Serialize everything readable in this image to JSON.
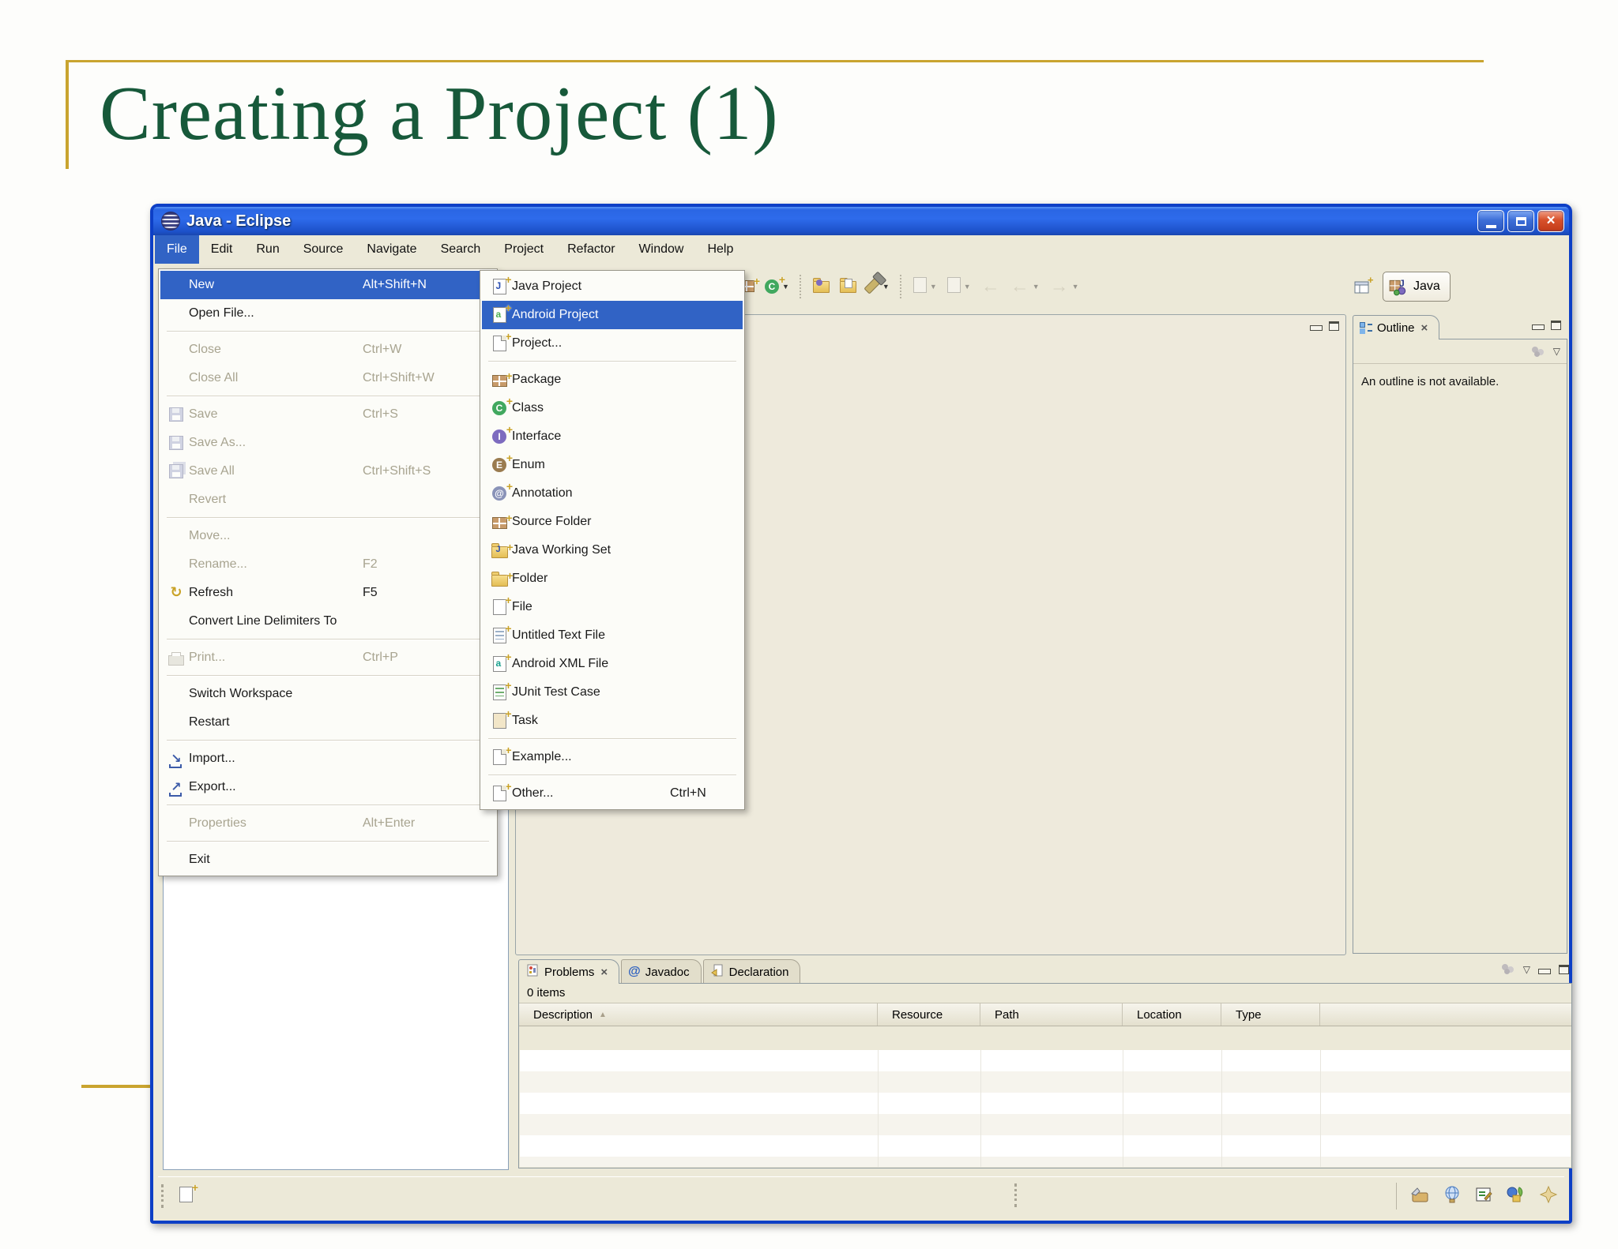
{
  "slide": {
    "title": "Creating a Project (1)"
  },
  "window": {
    "title": "Java - Eclipse",
    "menubar": [
      "File",
      "Edit",
      "Run",
      "Source",
      "Navigate",
      "Search",
      "Project",
      "Refactor",
      "Window",
      "Help"
    ],
    "file_menu": [
      {
        "label": "New",
        "shortcut": "Alt+Shift+N",
        "submenu": true,
        "highlighted": true
      },
      {
        "label": "Open File..."
      },
      {
        "sep": true
      },
      {
        "label": "Close",
        "shortcut": "Ctrl+W",
        "disabled": true
      },
      {
        "label": "Close All",
        "shortcut": "Ctrl+Shift+W",
        "disabled": true
      },
      {
        "sep": true
      },
      {
        "label": "Save",
        "shortcut": "Ctrl+S",
        "disabled": true,
        "icon": "save-icon"
      },
      {
        "label": "Save As...",
        "disabled": true,
        "icon": "save-as-icon"
      },
      {
        "label": "Save All",
        "shortcut": "Ctrl+Shift+S",
        "disabled": true,
        "icon": "save-all-icon"
      },
      {
        "label": "Revert",
        "disabled": true
      },
      {
        "sep": true
      },
      {
        "label": "Move...",
        "disabled": true
      },
      {
        "label": "Rename...",
        "shortcut": "F2",
        "disabled": true
      },
      {
        "label": "Refresh",
        "shortcut": "F5",
        "icon": "refresh-icon"
      },
      {
        "label": "Convert Line Delimiters To",
        "submenu": true
      },
      {
        "sep": true
      },
      {
        "label": "Print...",
        "shortcut": "Ctrl+P",
        "disabled": true,
        "icon": "print-icon"
      },
      {
        "sep": true
      },
      {
        "label": "Switch Workspace",
        "submenu": true
      },
      {
        "label": "Restart"
      },
      {
        "sep": true
      },
      {
        "label": "Import...",
        "icon": "import-icon"
      },
      {
        "label": "Export...",
        "icon": "export-icon"
      },
      {
        "sep": true
      },
      {
        "label": "Properties",
        "shortcut": "Alt+Enter",
        "disabled": true
      },
      {
        "sep": true
      },
      {
        "label": "Exit"
      }
    ],
    "new_submenu": [
      {
        "label": "Java Project",
        "icon": "java-project-icon"
      },
      {
        "label": "Android Project",
        "icon": "android-project-icon",
        "highlighted": true
      },
      {
        "label": "Project...",
        "icon": "project-icon"
      },
      {
        "sep": true
      },
      {
        "label": "Package",
        "icon": "package-icon"
      },
      {
        "label": "Class",
        "icon": "class-icon"
      },
      {
        "label": "Interface",
        "icon": "interface-icon"
      },
      {
        "label": "Enum",
        "icon": "enum-icon"
      },
      {
        "label": "Annotation",
        "icon": "annotation-icon"
      },
      {
        "label": "Source Folder",
        "icon": "source-folder-icon"
      },
      {
        "label": "Java Working Set",
        "icon": "java-working-set-icon"
      },
      {
        "label": "Folder",
        "icon": "folder-icon"
      },
      {
        "label": "File",
        "icon": "file-icon"
      },
      {
        "label": "Untitled Text File",
        "icon": "untitled-text-file-icon"
      },
      {
        "label": "Android XML File",
        "icon": "android-xml-file-icon"
      },
      {
        "label": "JUnit Test Case",
        "icon": "junit-test-case-icon"
      },
      {
        "label": "Task",
        "icon": "task-icon"
      },
      {
        "sep": true
      },
      {
        "label": "Example...",
        "icon": "example-icon"
      },
      {
        "sep": true
      },
      {
        "label": "Other...",
        "shortcut": "Ctrl+N",
        "icon": "other-icon"
      }
    ],
    "toolbar_icons": [
      {
        "name": "new-package-button",
        "icon": "new-package-icon"
      },
      {
        "name": "new-class-button",
        "icon": "new-class-icon",
        "dropdown": true
      },
      {
        "sep": true
      },
      {
        "name": "open-plugin-button",
        "icon": "open-plugin-icon"
      },
      {
        "name": "open-folder-button",
        "icon": "open-folder-icon"
      },
      {
        "name": "search-button",
        "icon": "search-icon",
        "dropdown": true
      },
      {
        "sep": true
      },
      {
        "name": "new-wizard-button",
        "icon": "dim-page-icon",
        "dropdown": true,
        "disabled": true
      },
      {
        "name": "run-last-tool-button",
        "icon": "dim-page-icon",
        "dropdown": true,
        "disabled": true
      },
      {
        "name": "last-edit-location-button",
        "icon": "back-arrow-icon",
        "disabled": true
      },
      {
        "name": "back-button",
        "icon": "back-arrow-icon",
        "dropdown": true,
        "disabled": true
      },
      {
        "name": "forward-button",
        "icon": "forward-arrow-icon",
        "dropdown": true,
        "disabled": true
      }
    ],
    "perspective": {
      "label": "Java"
    },
    "outline": {
      "title": "Outline",
      "message": "An outline is not available."
    },
    "problems_panel": {
      "tabs": [
        {
          "label": "Problems",
          "icon": "problems-icon",
          "selected": true
        },
        {
          "label": "Javadoc",
          "icon": "javadoc-icon"
        },
        {
          "label": "Declaration",
          "icon": "declaration-icon"
        }
      ],
      "status": "0 items",
      "columns": [
        "Description",
        "Resource",
        "Path",
        "Location",
        "Type"
      ]
    },
    "statusbar_icons": [
      {
        "name": "plugin-icon"
      },
      {
        "name": "web-browser-icon"
      },
      {
        "name": "tasks-icon"
      },
      {
        "name": "shapes-icon"
      },
      {
        "name": "star-icon"
      }
    ]
  }
}
